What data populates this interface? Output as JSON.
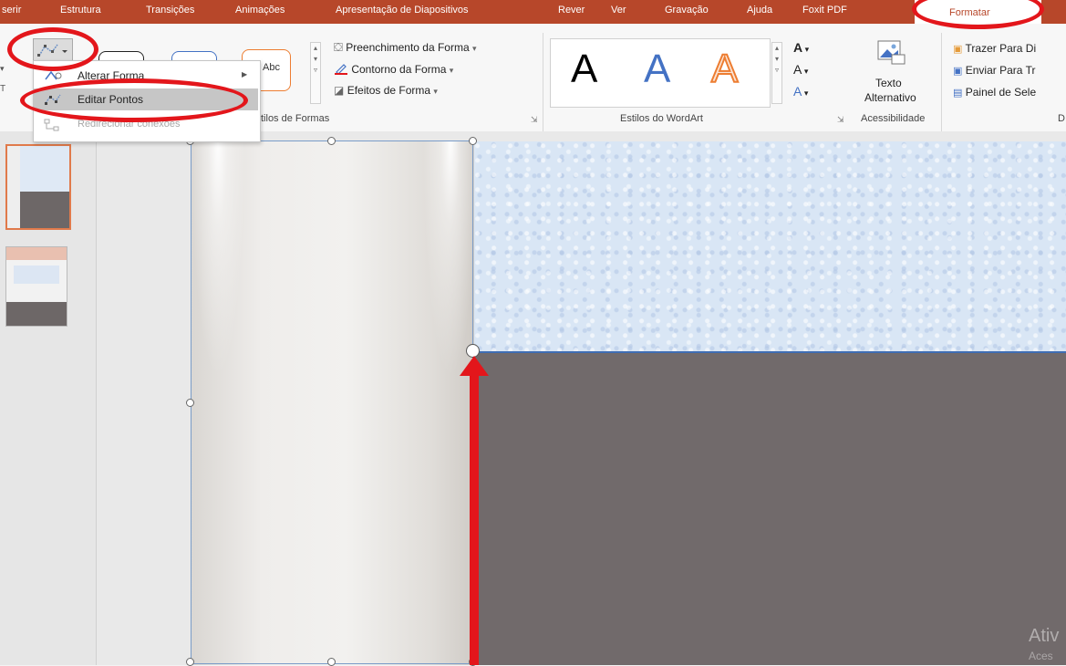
{
  "ribbon_tabs": [
    "serir",
    "Estrutura",
    "Transições",
    "Animações",
    "Apresentação de Diapositivos",
    "Rever",
    "Ver",
    "Gravação",
    "Ajuda",
    "Foxit PDF"
  ],
  "active_tab": "Formatar",
  "shape_styles": {
    "fill": "Preenchimento da Forma",
    "outline": "Contorno da Forma",
    "effects": "Efeitos de Forma",
    "group_label": "tilos de Formas",
    "abc_label": "Abc"
  },
  "wordart": {
    "letters": [
      "A",
      "A",
      "A"
    ],
    "group_label": "Estilos do WordArt"
  },
  "accessibility": {
    "button_line1": "Texto",
    "button_line2": "Alternativo",
    "group_label": "Acessibilidade"
  },
  "arrange": {
    "bring_forward": "Trazer Para Di",
    "send_backward": "Enviar Para Tr",
    "selection_pane": "Painel de Sele",
    "group_label_partial": "D"
  },
  "edit_shape_menu": {
    "items": [
      {
        "label": "Alterar Forma",
        "underline_char": "F",
        "state": "normal"
      },
      {
        "label": "Editar Pontos",
        "underline_char": "i",
        "state": "highlighted"
      },
      {
        "label": "Redirecionar conexões",
        "underline_char": "x",
        "state": "disabled"
      }
    ]
  },
  "watermark": {
    "line1": "Ativ",
    "line2": "Aces"
  },
  "colors": {
    "ribbon_accent": "#b7472a",
    "annotation_red": "#e3161b",
    "floor": "#716a6b",
    "wall_blue": "#d9e6f5",
    "wordart_blue": "#4472c4",
    "wordart_orange": "#ed7d31"
  }
}
